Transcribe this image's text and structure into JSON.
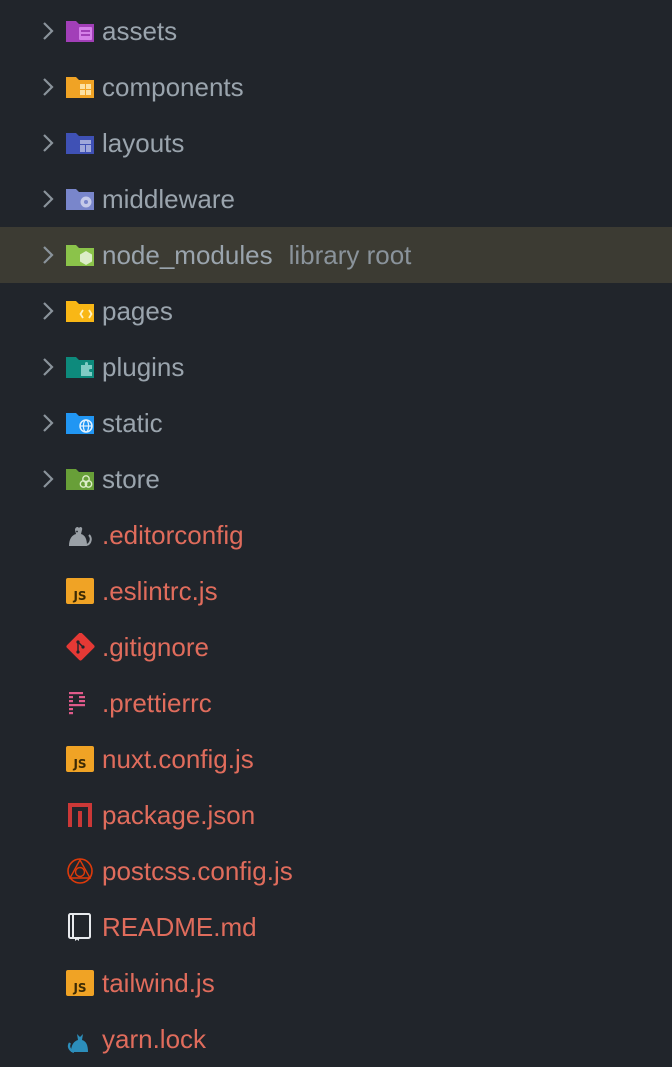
{
  "tree": {
    "folders": [
      {
        "label": "assets",
        "icon": "assets-folder-icon",
        "color": "#a23fb8"
      },
      {
        "label": "components",
        "icon": "components-folder-icon",
        "color": "#f0a325"
      },
      {
        "label": "layouts",
        "icon": "layouts-folder-icon",
        "color": "#3f51b5"
      },
      {
        "label": "middleware",
        "icon": "middleware-folder-icon",
        "color": "#7986cb"
      },
      {
        "label": "node_modules",
        "sublabel": "library root",
        "icon": "node-folder-icon",
        "color": "#8bc34a",
        "highlighted": true
      },
      {
        "label": "pages",
        "icon": "pages-folder-icon",
        "color": "#f9b715"
      },
      {
        "label": "plugins",
        "icon": "plugins-folder-icon",
        "color": "#0d8a7c"
      },
      {
        "label": "static",
        "icon": "static-folder-icon",
        "color": "#2196f3"
      },
      {
        "label": "store",
        "icon": "store-folder-icon",
        "color": "#689f38"
      }
    ],
    "files": [
      {
        "label": ".editorconfig",
        "icon": "editorconfig-icon"
      },
      {
        "label": ".eslintrc.js",
        "icon": "javascript-icon",
        "icon_text": "JS"
      },
      {
        "label": ".gitignore",
        "icon": "git-icon"
      },
      {
        "label": ".prettierrc",
        "icon": "prettier-icon"
      },
      {
        "label": "nuxt.config.js",
        "icon": "javascript-icon",
        "icon_text": "JS"
      },
      {
        "label": "package.json",
        "icon": "npm-icon"
      },
      {
        "label": "postcss.config.js",
        "icon": "postcss-icon"
      },
      {
        "label": "README.md",
        "icon": "readme-book-icon"
      },
      {
        "label": "tailwind.js",
        "icon": "javascript-icon",
        "icon_text": "JS"
      },
      {
        "label": "yarn.lock",
        "icon": "yarn-cat-icon"
      }
    ]
  },
  "colors": {
    "background": "#21252b",
    "highlight_row": "#3c3b33",
    "folder_text": "#9aa4ad",
    "file_text": "#e06c5c",
    "chevron": "#8a939b"
  }
}
